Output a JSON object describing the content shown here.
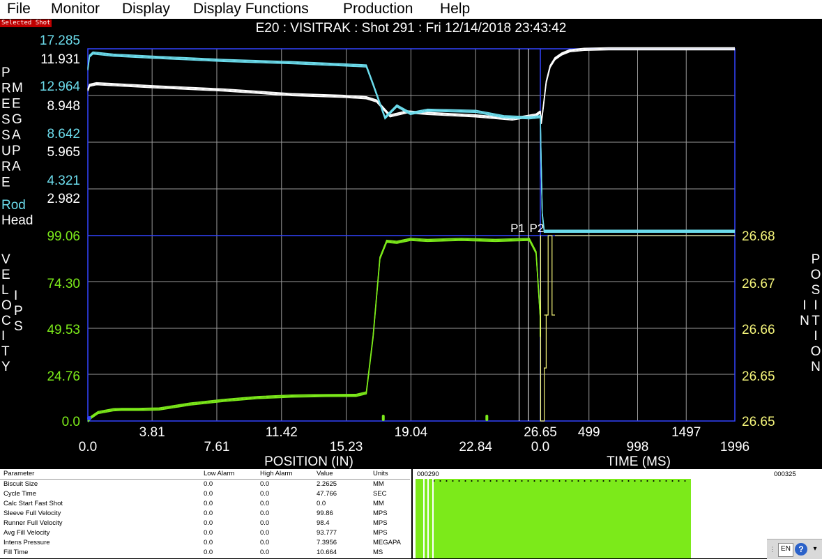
{
  "menu": [
    "File",
    "Monitor",
    "Display",
    "Display Functions",
    "Production",
    "Help"
  ],
  "selected_shot_label": "Selected Shot",
  "title": "E20 : VISITRAK : Shot 291 : Fri   12/14/2018   23:43:42",
  "colors": {
    "rod": "#6cdcec",
    "head": "#ffffff",
    "velocity": "#7cea1a",
    "position": "#f4f47a",
    "grid": "#9a9a9a",
    "axis": "#3344ff"
  },
  "chart_data": [
    {
      "type": "line",
      "name": "pressure-plot",
      "ylabel": "PRESSURE MEGAPA",
      "y_ticks_rod": [
        "17.285",
        "12.964",
        "8.642",
        "4.321"
      ],
      "y_ticks_head": [
        "11.931",
        "8.948",
        "5.965",
        "2.982"
      ],
      "series": [
        {
          "name": "Rod",
          "x_position": [
            0.0,
            0.1,
            0.3,
            1.5,
            4.0,
            8.0,
            12.0,
            15.0,
            16.4,
            16.8,
            17.5,
            18.2,
            19.0,
            20.0,
            22.84,
            24.5,
            26.0,
            26.65
          ],
          "y_position": [
            15.4,
            16.6,
            16.9,
            16.7,
            16.5,
            16.2,
            16.0,
            15.8,
            15.7,
            14.0,
            10.9,
            12.0,
            11.3,
            11.6,
            11.5,
            11.0,
            10.9,
            11.0
          ],
          "x_time": [
            0,
            8,
            20,
            40,
            60,
            100,
            200,
            400,
            998,
            1996
          ],
          "y_time": [
            11.0,
            7.0,
            2.0,
            0.4,
            0.4,
            0.4,
            0.4,
            0.4,
            0.4,
            0.4
          ]
        },
        {
          "name": "Head",
          "x_position": [
            0.0,
            0.1,
            0.5,
            4.0,
            8.0,
            12.0,
            15.0,
            16.4,
            17.0,
            17.8,
            18.8,
            20.0,
            22.84,
            25.0,
            26.4,
            26.65
          ],
          "y_position": [
            9.3,
            9.6,
            9.7,
            9.5,
            9.3,
            9.0,
            8.9,
            8.8,
            8.6,
            7.65,
            7.9,
            7.8,
            7.65,
            7.45,
            7.7,
            7.9
          ],
          "x_time": [
            0,
            10,
            30,
            60,
            100,
            150,
            220,
            300,
            450,
            700,
            998,
            1996
          ],
          "y_time": [
            7.9,
            7.2,
            8.2,
            9.8,
            10.8,
            11.3,
            11.6,
            11.8,
            11.9,
            11.93,
            11.93,
            11.93
          ]
        }
      ]
    },
    {
      "type": "line",
      "name": "velocity-position-plot",
      "xlabel_left": "POSITION (IN)",
      "xlabel_right": "TIME (MS)",
      "x_ticks_position_upper": [
        "3.81",
        "11.42",
        "19.04",
        "26.65"
      ],
      "x_ticks_position_lower": [
        "0.0",
        "7.61",
        "15.23",
        "22.84"
      ],
      "x_ticks_time_upper": [
        "499",
        "1497"
      ],
      "x_ticks_time_lower": [
        "0.0",
        "998",
        "1996"
      ],
      "y_ticks_velocity": [
        "99.06",
        "74.30",
        "49.53",
        "24.76",
        "0.0"
      ],
      "y_ticks_position": [
        "26.68",
        "26.67",
        "26.66",
        "26.65",
        "26.65"
      ],
      "ylabel_left": "VELOCITY IPS",
      "ylabel_right": "POSITION IN",
      "markers": [
        "P1",
        "P2"
      ],
      "marker_x_position": [
        25.4,
        25.95
      ],
      "series": [
        {
          "name": "Velocity",
          "x": [
            0.0,
            0.2,
            0.6,
            1.5,
            2.0,
            3.0,
            4.2,
            6.0,
            8.0,
            10.0,
            12.0,
            14.0,
            15.8,
            16.4,
            16.8,
            17.2,
            17.6,
            18.2,
            19.0,
            20.0,
            22.0,
            24.0,
            26.0,
            26.4,
            26.65
          ],
          "y": [
            0.0,
            2.0,
            4.5,
            6.0,
            6.2,
            6.2,
            6.4,
            9.0,
            11.0,
            12.5,
            13.3,
            13.6,
            13.7,
            15.0,
            45.0,
            87.0,
            96.0,
            95.5,
            97.0,
            96.5,
            97.0,
            96.5,
            97.0,
            90.0,
            55.0
          ]
        },
        {
          "name": "Position",
          "x_time": [
            0,
            3,
            3,
            40,
            40,
            60,
            60,
            80,
            80,
            120,
            120,
            150
          ],
          "y_time": [
            26.68,
            26.68,
            26.645,
            26.645,
            26.655,
            26.655,
            26.665,
            26.665,
            26.68,
            26.68,
            26.665,
            26.665
          ]
        }
      ]
    }
  ],
  "legend": {
    "rod": "Rod",
    "head": "Head"
  },
  "params": {
    "headers": [
      "Parameter",
      "Low Alarm",
      "High Alarm",
      "Value",
      "Units"
    ],
    "rows": [
      [
        "Biscuit Size",
        "0.0",
        "0.0",
        "2.2625",
        "MM"
      ],
      [
        "Cycle Time",
        "0.0",
        "0.0",
        "47.766",
        "SEC"
      ],
      [
        "Calc Start Fast Shot",
        "0.0",
        "0.0",
        "0.0",
        "MM"
      ],
      [
        "Sleeve Full Velocity",
        "0.0",
        "0.0",
        "99.86",
        "MPS"
      ],
      [
        "Runner Full Velocity",
        "0.0",
        "0.0",
        "98.4",
        "MPS"
      ],
      [
        "Avg Fill Velocity",
        "0.0",
        "0.0",
        "93.777",
        "MPS"
      ],
      [
        "Intens Pressure",
        "0.0",
        "0.0",
        "7.3956",
        "MEGAPA"
      ],
      [
        "Fill Time",
        "0.0",
        "0.0",
        "10.664",
        "MS"
      ]
    ]
  },
  "shot_range": {
    "start": "000290",
    "end": "000325"
  },
  "tray": {
    "lang": "EN",
    "help": "?"
  }
}
